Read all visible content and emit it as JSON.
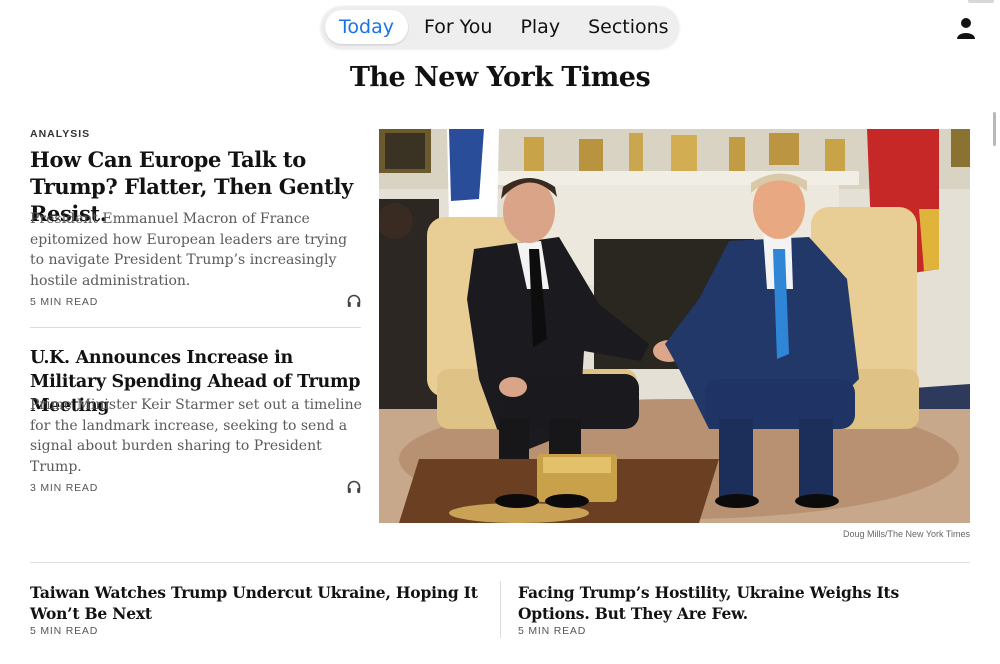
{
  "nav": {
    "tabs": [
      {
        "label": "Today",
        "active": true
      },
      {
        "label": "For You",
        "active": false
      },
      {
        "label": "Play",
        "active": false
      },
      {
        "label": "Sections",
        "active": false
      }
    ],
    "accent_color": "#1a73e8"
  },
  "masthead": "The New York Times",
  "icons": {
    "profile": "person-icon",
    "audio": "headphones-icon"
  },
  "lead": {
    "kicker": "ANALYSIS",
    "headline": "How Can Europe Talk to Trump? Flatter, Then Gently Resist.",
    "summary": "President Emmanuel Macron of France epitomized how European leaders are trying to navigate President Trump’s increasingly hostile administration.",
    "read_time": "5 MIN READ"
  },
  "second": {
    "headline": "U.K. Announces Increase in Military Spending Ahead of Trump Meeting",
    "summary": "Prime Minister Keir Starmer set out a timeline for the landmark increase, seeking to send a signal about burden sharing to President Trump.",
    "read_time": "3 MIN READ"
  },
  "photo": {
    "credit": "Doug Mills/The New York Times"
  },
  "bottom": [
    {
      "headline": "Taiwan Watches Trump Undercut Ukraine, Hoping It Won’t Be Next",
      "read_time": "5 MIN READ"
    },
    {
      "headline": "Facing Trump’s Hostility, Ukraine Weighs Its Options. But They Are Few.",
      "read_time": "5 MIN READ"
    }
  ]
}
